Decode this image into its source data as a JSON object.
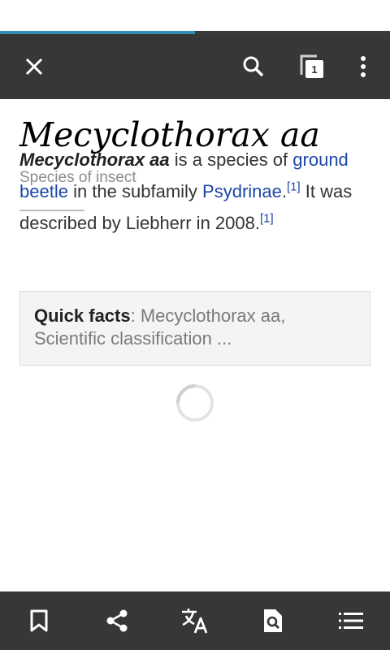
{
  "page_load_progress_percent": 50,
  "colors": {
    "toolbar_bg": "#373737",
    "progress_fill": "#2f8fb0",
    "link": "#1d46a8"
  },
  "toolbar": {
    "close_icon": "close-icon",
    "search_icon": "search-icon",
    "tabs_icon": "tabs-icon",
    "tab_count": "1",
    "overflow_icon": "more-vert-icon"
  },
  "article": {
    "title": "Mecyclothorax aa",
    "subtitle": "Species of insect",
    "para_bold": "Mecyclothorax aa",
    "para_t1": " is a species of ",
    "link_ground_beetle": "ground beetle",
    "para_t2": " in the subfamily ",
    "link_psydrinae": "Psydrinae",
    "para_t3": ".",
    "ref1": "[1]",
    "para_t4": " It was described by Liebherr in 2008.",
    "ref2": "[1]"
  },
  "quick_facts": {
    "label": "Quick facts",
    "text": ": Mecyclothorax aa, Scientific classification ..."
  },
  "bottom_bar": {
    "icons": [
      "bookmark-icon",
      "share-icon",
      "translate-icon",
      "find-in-page-icon",
      "table-of-contents-icon"
    ]
  }
}
